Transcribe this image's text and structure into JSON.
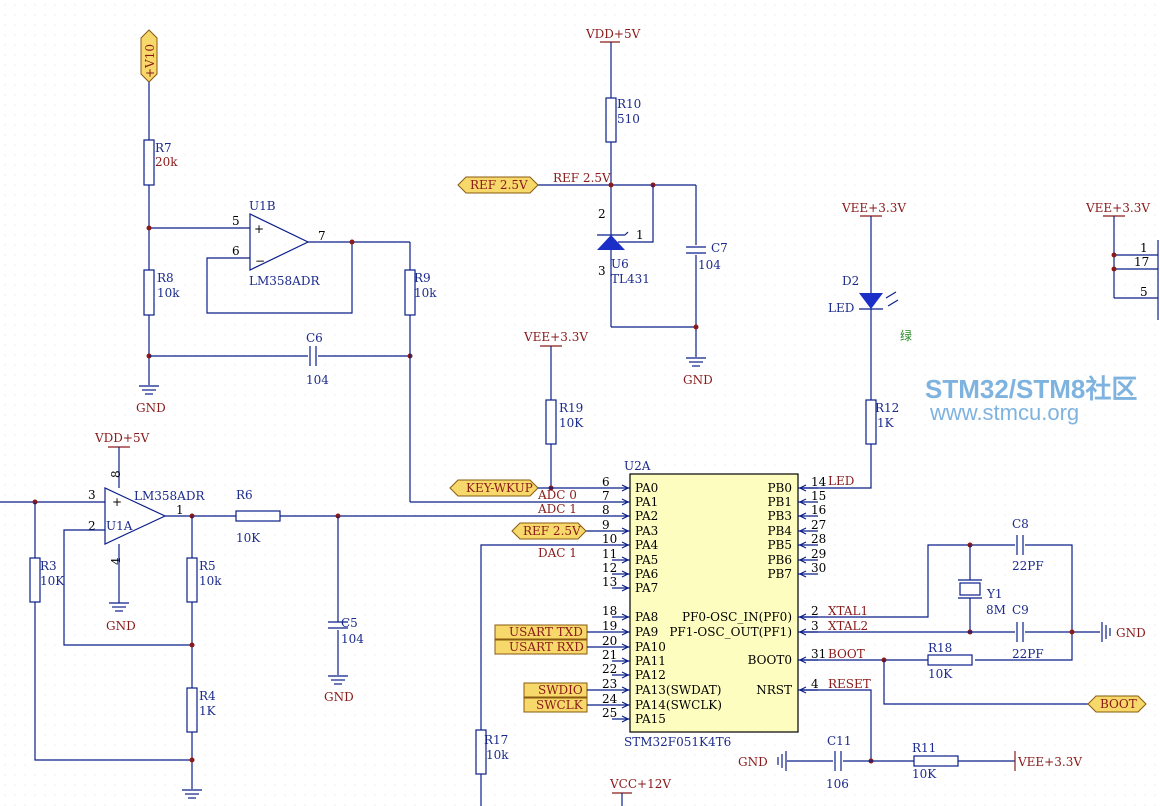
{
  "power": {
    "v10": "+V10",
    "vdd_top": "VDD+5V",
    "vdd_left": "VDD+5V",
    "vee_r19": "VEE+3.3V",
    "vee_led": "VEE+3.3V",
    "vee_right": "VEE+3.3V",
    "vee_bottom": "VEE+3.3V",
    "vcc": "VCC+12V",
    "gnd": "GND"
  },
  "components": {
    "r7": {
      "ref": "R7",
      "val": "20k"
    },
    "r8": {
      "ref": "R8",
      "val": "10k"
    },
    "r9": {
      "ref": "R9",
      "val": "10k"
    },
    "r10": {
      "ref": "R10",
      "val": "510"
    },
    "r19": {
      "ref": "R19",
      "val": "10K"
    },
    "r12": {
      "ref": "R12",
      "val": "1K"
    },
    "r6": {
      "ref": "R6",
      "val": "10K"
    },
    "r3": {
      "ref": "R3",
      "val": "10K"
    },
    "r5": {
      "ref": "R5",
      "val": "10k"
    },
    "r4": {
      "ref": "R4",
      "val": "1K"
    },
    "r17": {
      "ref": "R17",
      "val": "10k"
    },
    "r18": {
      "ref": "R18",
      "val": "10K"
    },
    "r11": {
      "ref": "R11",
      "val": "10K"
    },
    "c6": {
      "ref": "C6",
      "val": "104"
    },
    "c7": {
      "ref": "C7",
      "val": "104"
    },
    "c5": {
      "ref": "C5",
      "val": "104"
    },
    "c8": {
      "ref": "C8",
      "val": "22PF"
    },
    "c9": {
      "ref": "C9",
      "val": "22PF"
    },
    "c11": {
      "ref": "C11",
      "val": "106"
    },
    "u1b": {
      "ref": "U1B",
      "part": "LM358ADR"
    },
    "u1a": {
      "ref": "U1A",
      "part": "LM358ADR"
    },
    "u6": {
      "ref": "U6",
      "part": "TL431"
    },
    "d2": {
      "ref": "D2",
      "part": "LED",
      "color": "绿"
    },
    "y1": {
      "ref": "Y1",
      "val": "8M"
    },
    "u2a": {
      "ref": "U2A",
      "part": "STM32F051K4T6"
    }
  },
  "pin_numbers": {
    "u1b_5": "5",
    "u1b_6": "6",
    "u1b_7": "7",
    "u1a_3": "3",
    "u1a_2": "2",
    "u1a_1": "1",
    "u1a_8": "8",
    "u1a_4": "4",
    "u6_2": "2",
    "u6_1": "1",
    "u6_3": "3",
    "conn_1": "1",
    "conn_17": "17",
    "conn_5": "5"
  },
  "mcu_left_pins": [
    {
      "num": "6",
      "name": "PA0"
    },
    {
      "num": "7",
      "name": "PA1"
    },
    {
      "num": "8",
      "name": "PA2"
    },
    {
      "num": "9",
      "name": "PA3"
    },
    {
      "num": "10",
      "name": "PA4"
    },
    {
      "num": "11",
      "name": "PA5"
    },
    {
      "num": "12",
      "name": "PA6"
    },
    {
      "num": "13",
      "name": "PA7"
    },
    {
      "num": "18",
      "name": "PA8"
    },
    {
      "num": "19",
      "name": "PA9"
    },
    {
      "num": "20",
      "name": "PA10"
    },
    {
      "num": "21",
      "name": "PA11"
    },
    {
      "num": "22",
      "name": "PA12"
    },
    {
      "num": "23",
      "name": "PA13(SWDAT)"
    },
    {
      "num": "24",
      "name": "PA14(SWCLK)"
    },
    {
      "num": "25",
      "name": "PA15"
    }
  ],
  "mcu_right_pins": [
    {
      "num": "14",
      "name": "PB0"
    },
    {
      "num": "15",
      "name": "PB1"
    },
    {
      "num": "16",
      "name": "PB3"
    },
    {
      "num": "27",
      "name": "PB4"
    },
    {
      "num": "28",
      "name": "PB5"
    },
    {
      "num": "29",
      "name": "PB6"
    },
    {
      "num": "30",
      "name": "PB7"
    },
    {
      "num": "2",
      "name": "PF0-OSC_IN(PF0)"
    },
    {
      "num": "3",
      "name": "PF1-OSC_OUT(PF1)"
    },
    {
      "num": "31",
      "name": "BOOT0"
    },
    {
      "num": "4",
      "name": "NRST"
    }
  ],
  "nets": {
    "ref25": "REF 2.5V",
    "adc0": "ADC 0",
    "adc1": "ADC 1",
    "dac1": "DAC 1",
    "led": "LED",
    "xtal1": "XTAL1",
    "xtal2": "XTAL2",
    "boot": "BOOT",
    "reset": "RESET"
  },
  "ports": {
    "ref_top": "REF 2.5V",
    "keywkup": "KEY-WKUP",
    "ref_mcu": "REF 2.5V",
    "usart_tx": "USART TXD",
    "usart_rx": "USART RXD",
    "swdio": "SWDIO",
    "swclk": "SWCLK",
    "boot": "BOOT",
    "v10": "+V10"
  },
  "watermark": {
    "title": "STM32/STM8社区",
    "url": "www.stmcu.org"
  },
  "colors": {
    "wire": "#0b1f8a",
    "net": "#8a1a1a",
    "port_fill": "#f7d86a",
    "chip_fill": "#fdfdbf",
    "watermark": "#7fb3df",
    "led_note": "#2a8a2a"
  }
}
